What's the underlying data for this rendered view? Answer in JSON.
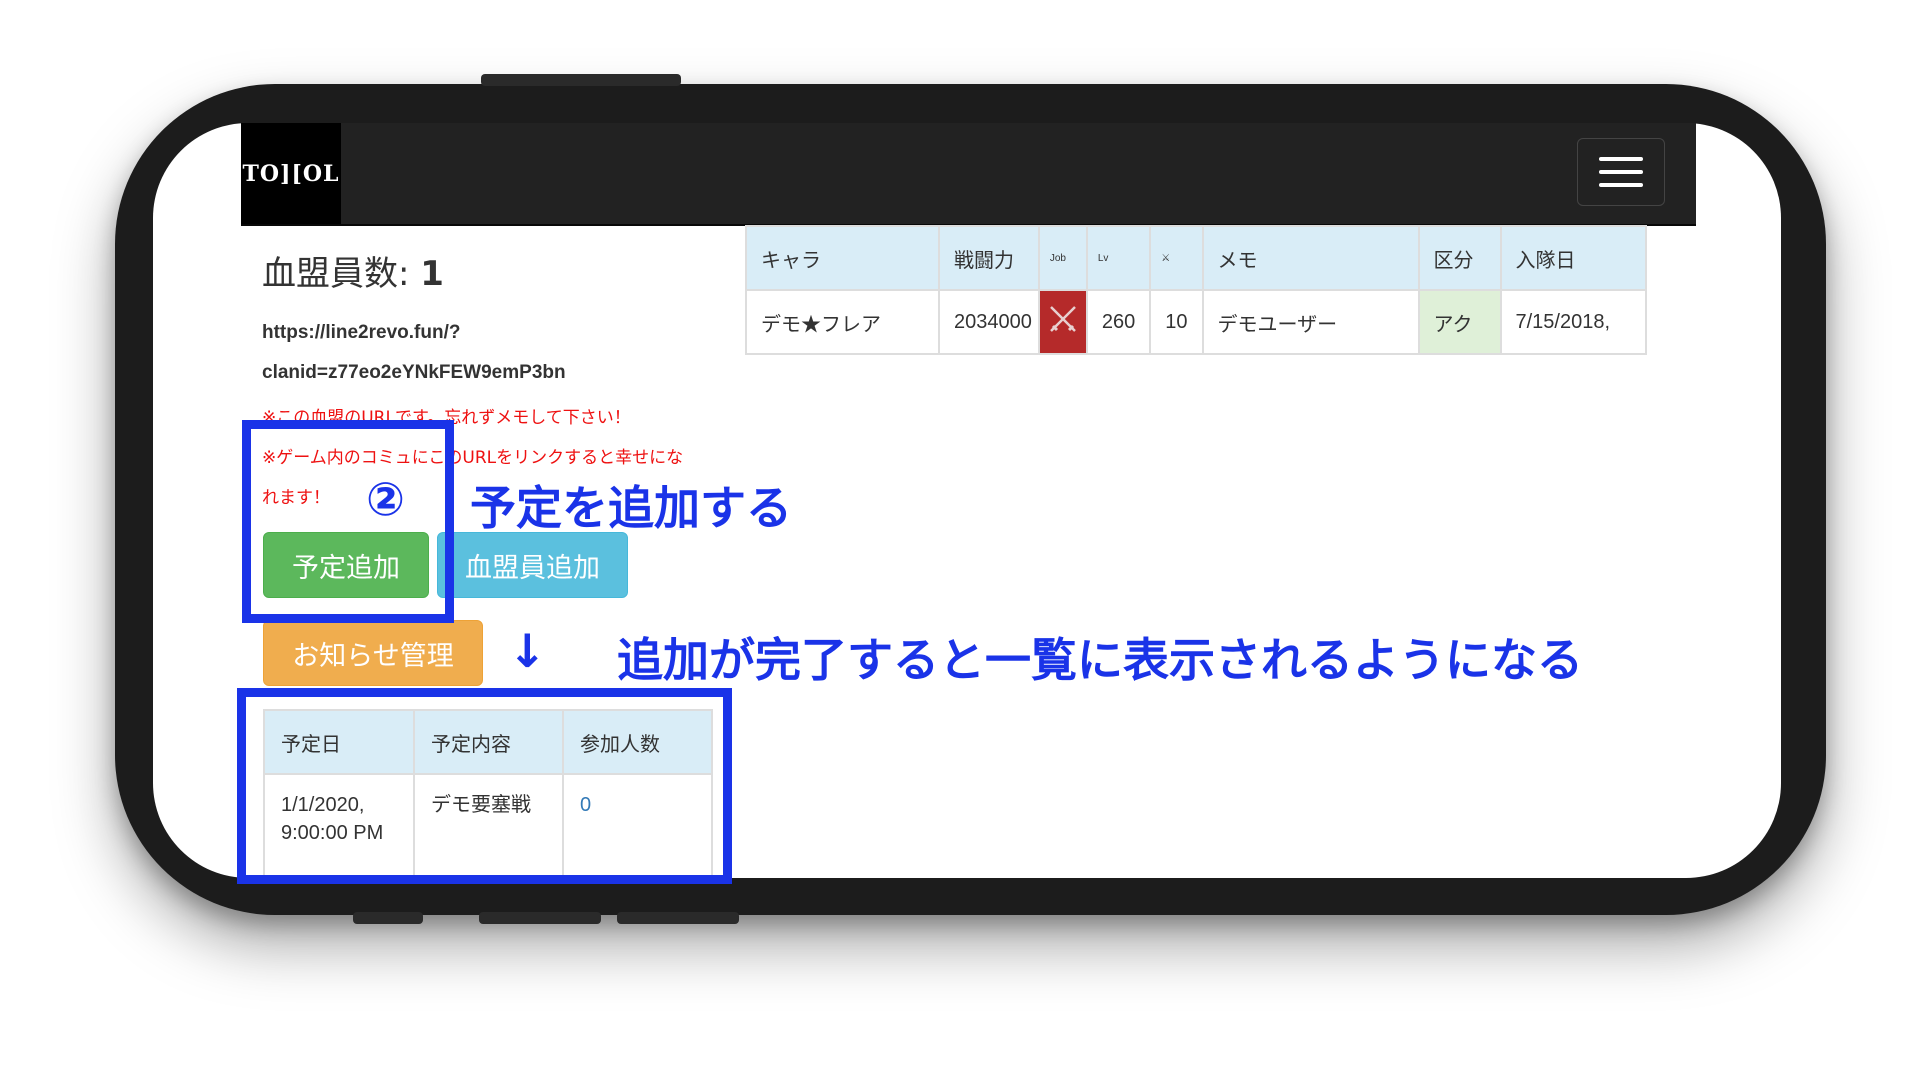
{
  "navbar": {
    "logo_text": "TO][OL"
  },
  "member_table": {
    "headers": [
      "キャラ",
      "戦闘力",
      "Job",
      "Lv",
      "⚔",
      "メモ",
      "区分",
      "入隊日"
    ],
    "rows": [
      {
        "name": "デモ★フレア",
        "power": "2034000",
        "job_icon": "swords-icon",
        "lv": "260",
        "x": "10",
        "memo": "デモユーザー",
        "kubun": "アク",
        "joined": "7/15/2018,"
      }
    ]
  },
  "main": {
    "member_count_label": "血盟員数: ",
    "member_count": "1",
    "url_line1": "https://line2revo.fun/?",
    "url_line2": "clanid=z77eo2eYNkFEW9emP3bn",
    "note1": "※この血盟のURLです。忘れずメモして下さい！",
    "note2": "※ゲーム内のコミュにこのURLをリンクすると幸せにな",
    "note3": "れます！"
  },
  "buttons": {
    "add_schedule": "予定追加",
    "add_member": "血盟員追加",
    "notice_manage": "お知らせ管理"
  },
  "schedule_table": {
    "headers": [
      "予定日",
      "予定内容",
      "参加人数"
    ],
    "rows": [
      {
        "date_line1": "1/1/2020,",
        "date_line2": "9:00:00 PM",
        "content": "デモ要塞戦",
        "count": "0"
      }
    ]
  },
  "annotations": {
    "step_number": "②",
    "step_text": "予定を追加する",
    "arrow": "↓",
    "result_text": "追加が完了すると一覧に表示されるようになる"
  },
  "colors": {
    "annotation": "#1a33e8",
    "navbar": "#222222"
  }
}
